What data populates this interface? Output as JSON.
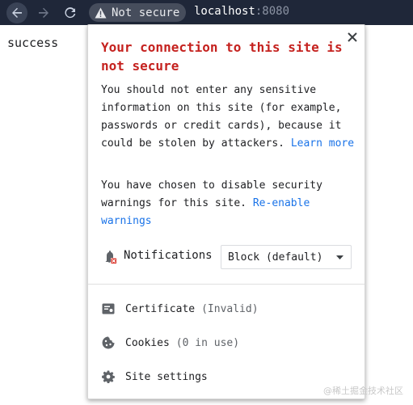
{
  "browser": {
    "security_chip": "Not secure",
    "url_host": "localhost",
    "url_port": ":8080",
    "icons": [
      "arrow-left-icon",
      "arrow-right-icon",
      "reload-icon",
      "warning-icon"
    ]
  },
  "page": {
    "body_text": "success"
  },
  "popup": {
    "title": "Your connection to this site is not secure",
    "warning_text": "You should not enter any sensitive information on this site (for example, passwords or credit cards), because it could be stolen by attackers. ",
    "learn_more": "Learn more",
    "disabled_text": "You have chosen to disable security warnings for this site. ",
    "reenable": "Re-enable warnings",
    "notifications": {
      "label": "Notifications",
      "value": "Block (default)"
    },
    "items": [
      {
        "label": "Certificate",
        "sub": "(Invalid)",
        "icon": "certificate-icon"
      },
      {
        "label": "Cookies",
        "sub": "(0 in use)",
        "icon": "cookie-icon"
      },
      {
        "label": "Site settings",
        "sub": "",
        "icon": "gear-icon"
      }
    ],
    "title_color": "#c5221f",
    "link_color": "#1a73e8"
  },
  "watermark": "@稀土掘金技术社区"
}
